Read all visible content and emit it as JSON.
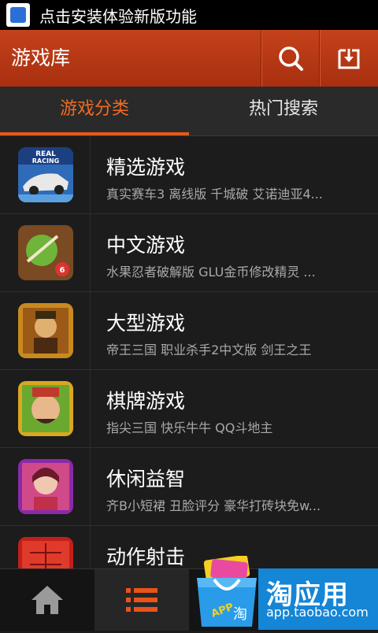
{
  "status_bar": {
    "notification_text": "点击安装体验新版功能"
  },
  "header": {
    "title": "游戏库"
  },
  "tabs": [
    {
      "label": "游戏分类"
    },
    {
      "label": "热门搜索"
    }
  ],
  "categories": [
    {
      "title": "精选游戏",
      "subtitle": "真实赛车3 离线版   千城破   艾诺迪亚4...",
      "icon_label": "REAL RACING"
    },
    {
      "title": "中文游戏",
      "subtitle": "水果忍者破解版   GLU金币修改精灵   ..."
    },
    {
      "title": "大型游戏",
      "subtitle": "帝王三国   职业杀手2中文版   剑王之王"
    },
    {
      "title": "棋牌游戏",
      "subtitle": "指尖三国   快乐牛牛   QQ斗地主"
    },
    {
      "title": "休闲益智",
      "subtitle": "齐B小短裙   丑脸评分   豪华打砖块免w..."
    },
    {
      "title": "动作射击",
      "subtitle": ""
    }
  ],
  "banner": {
    "title": "淘应用",
    "url": "app.taobao.com",
    "bag_text": "APP",
    "bag_char": "淘"
  },
  "colors": {
    "accent": "#f26b21",
    "header": "#b7391a",
    "banner": "#1585d6"
  }
}
